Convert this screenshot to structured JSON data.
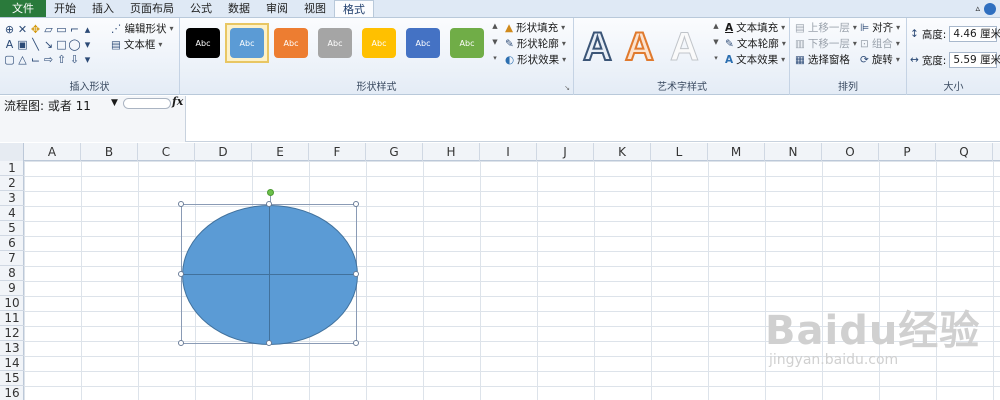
{
  "menubar": {
    "tabs": [
      "文件",
      "开始",
      "插入",
      "页面布局",
      "公式",
      "数据",
      "审阅",
      "视图",
      "格式"
    ]
  },
  "ribbon": {
    "insert_shapes": {
      "label": "插入形状",
      "edit_shape": "编辑形状",
      "text_box": "文本框"
    },
    "shape_styles": {
      "label": "形状样式",
      "presets": [
        "Abc",
        "Abc",
        "Abc",
        "Abc",
        "Abc",
        "Abc",
        "Abc"
      ],
      "preset_colors": [
        "#000000",
        "#5b9bd5",
        "#ed7d31",
        "#a5a5a5",
        "#ffc000",
        "#4472c4",
        "#70ad47"
      ],
      "shape_fill": "形状填充",
      "shape_outline": "形状轮廓",
      "shape_effects": "形状效果"
    },
    "wordart_styles": {
      "label": "艺术字样式",
      "text_fill": "文本填充",
      "text_outline": "文本轮廓",
      "text_effects": "文本效果"
    },
    "arrange": {
      "label": "排列",
      "bring_forward": "上移一层",
      "send_backward": "下移一层",
      "selection_pane": "选择窗格",
      "align": "对齐",
      "group": "组合",
      "rotate": "旋转"
    },
    "size": {
      "label": "大小",
      "height_label": "高度:",
      "height_value": "4.46 厘米",
      "width_label": "宽度:",
      "width_value": "5.59 厘米"
    }
  },
  "formula_bar": {
    "name_box": "流程图: 或者 11",
    "fx": "fx"
  },
  "sheet": {
    "columns": [
      "A",
      "B",
      "C",
      "D",
      "E",
      "F",
      "G",
      "H",
      "I",
      "J",
      "K",
      "L",
      "M",
      "N",
      "O",
      "P",
      "Q"
    ],
    "rows": [
      "1",
      "2",
      "3",
      "4",
      "5",
      "6",
      "7",
      "8",
      "9",
      "10",
      "11",
      "12",
      "13",
      "14",
      "15",
      "16"
    ]
  },
  "watermark": {
    "logo_text": "Baidu经验",
    "url": "jingyan.baidu.com"
  }
}
